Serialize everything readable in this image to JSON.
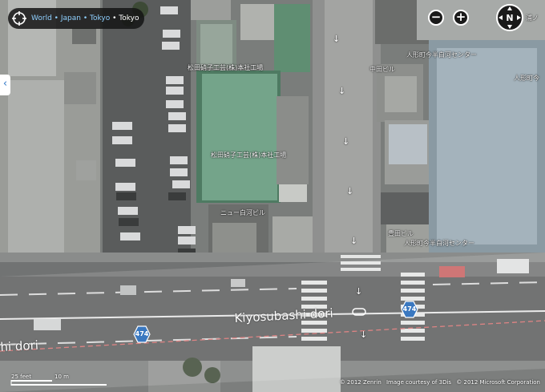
{
  "breadcrumb": {
    "world": "World",
    "japan": "Japan",
    "tokyo_link": "Tokyo",
    "current": "Tokyo",
    "separator": "•"
  },
  "controls": {
    "zoom_out": "−",
    "zoom_in": "+",
    "compass_north": "N",
    "side_toggle": "‹"
  },
  "map_labels": {
    "factory_top": "松田硝子工芸(株)本社工場",
    "factory_mid": "松田硝子工芸(株)本社工場",
    "new_shirakawa": "ニュー白河ビル",
    "nakata": "中田ビル",
    "ningyocho_top": "人形町今半白河センター",
    "ningyocho_right": "人形町今",
    "edge_top_right": "浦ノ",
    "toyoda": "豊田ビル",
    "ningyocho_bottom": "人形町今半白河センター",
    "road_main": "Kiyosubashi dori",
    "road_left": "hi dori"
  },
  "route_shields": [
    {
      "number": "474"
    },
    {
      "number": "474"
    }
  ],
  "scale": {
    "feet_label": "25 feet",
    "meters_label": "10 m"
  },
  "attribution": {
    "zenrin": "© 2012 Zenrin",
    "imagery": "Image courtesy of 3Dis",
    "microsoft": "© 2012 Microsoft Corporation"
  },
  "colors": {
    "road_shield": "#3a78c0",
    "link_blue": "#8fd0ff",
    "route_line": "#d97070"
  },
  "icons": {
    "breadcrumb": "crosshair-icon",
    "zoom_out": "minus-icon",
    "zoom_in": "plus-icon",
    "compass": "compass-icon",
    "side_toggle": "chevron-left-icon",
    "one_way": "arrow-down-icon"
  }
}
